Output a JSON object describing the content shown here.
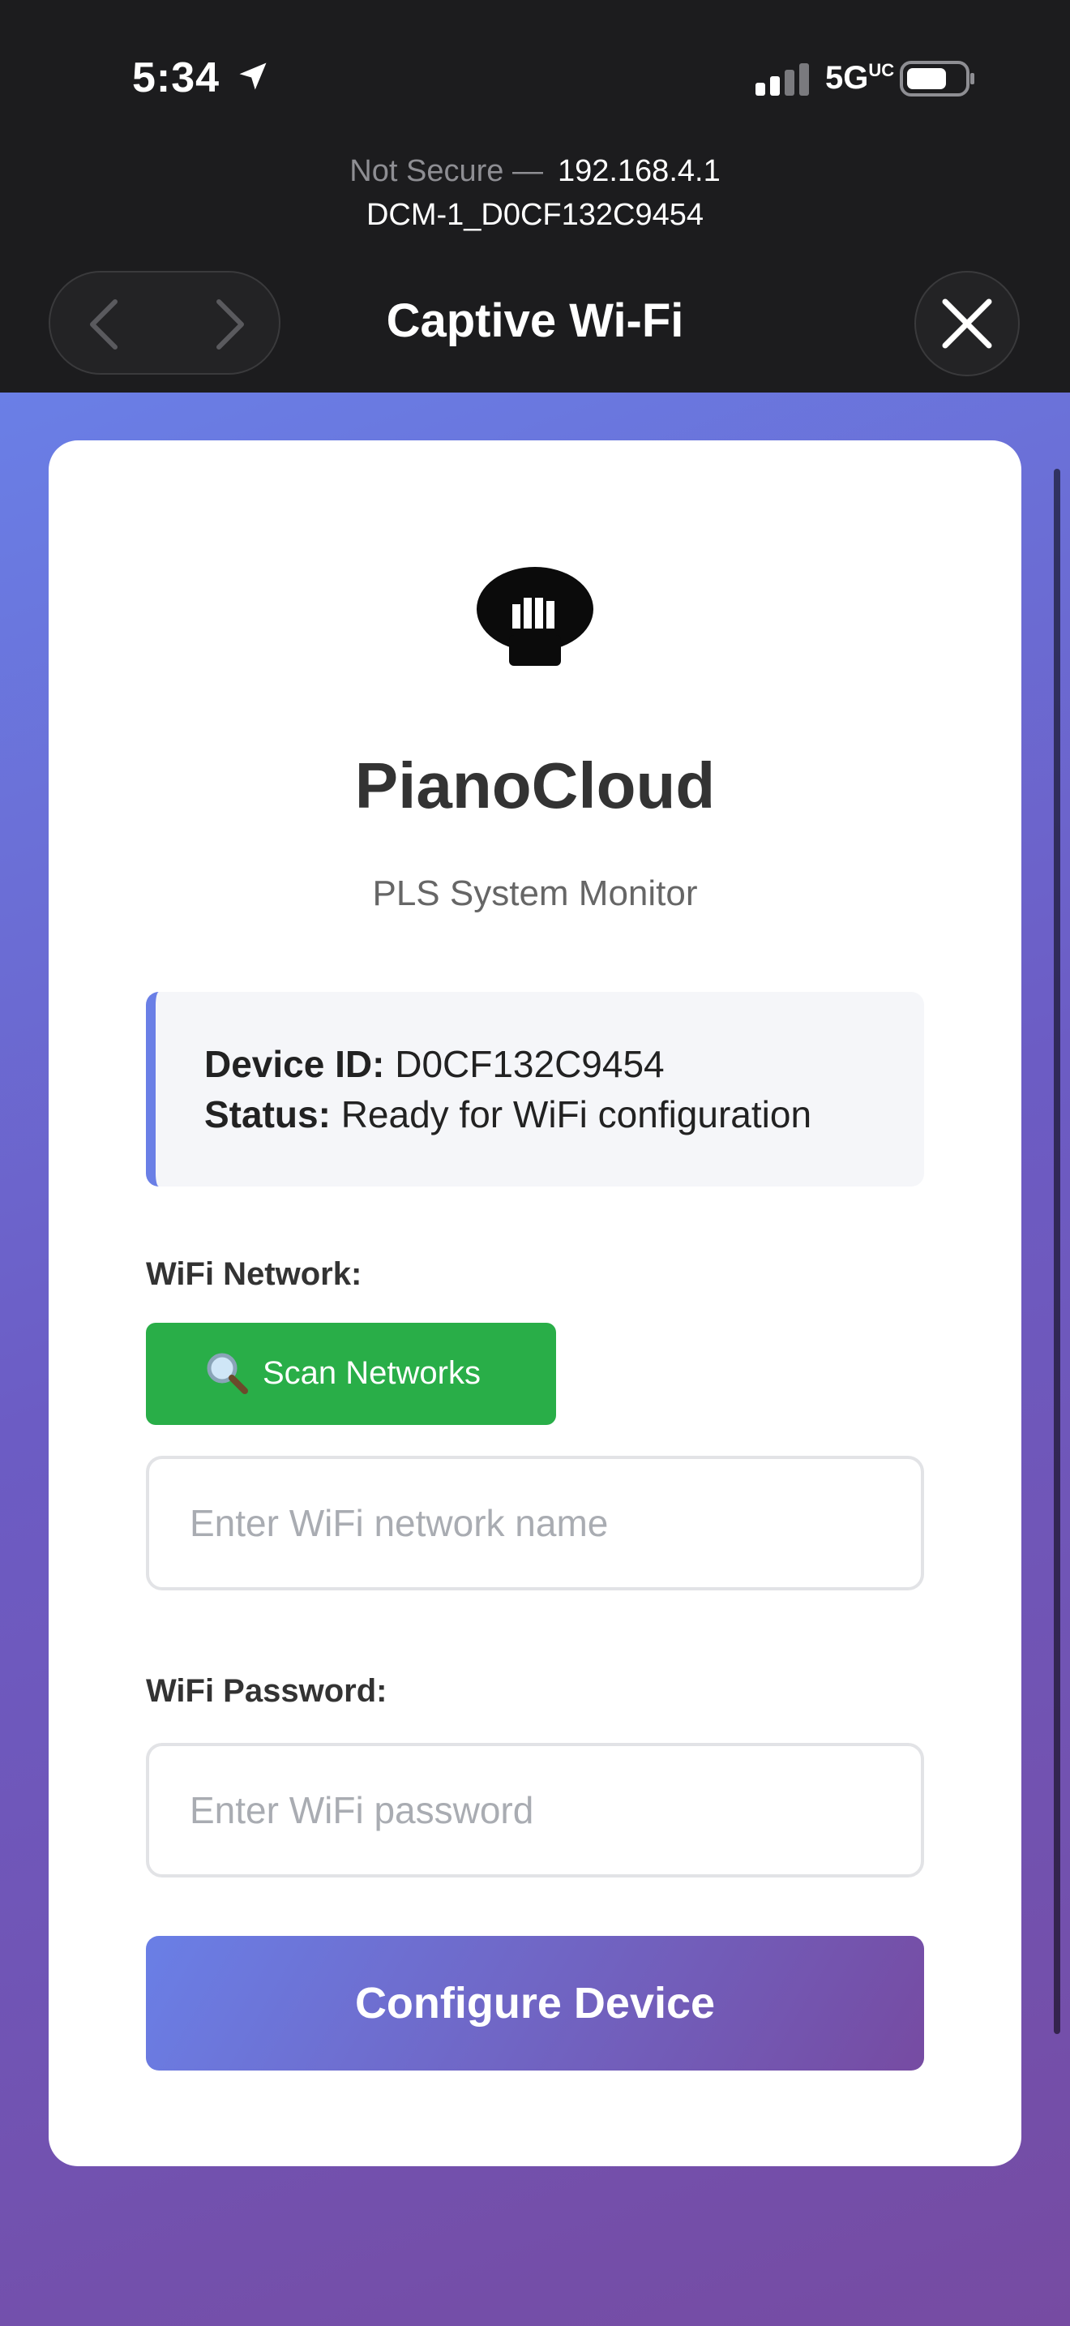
{
  "status_bar": {
    "time": "5:34",
    "network": "5G",
    "network_suffix": "UC"
  },
  "browser": {
    "security_label": "Not Secure —",
    "host": "192.168.4.1",
    "ssid": "DCM-1_D0CF132C9454",
    "title": "Captive Wi-Fi"
  },
  "app": {
    "name": "PianoCloud",
    "tagline": "PLS System Monitor"
  },
  "device_info": {
    "id_label": "Device ID:",
    "id_value": "D0CF132C9454",
    "status_label": "Status:",
    "status_value": "Ready for WiFi configuration"
  },
  "form": {
    "network_label": "WiFi Network:",
    "scan_button": "Scan Networks",
    "network_placeholder": "Enter WiFi network name",
    "network_value": "",
    "password_label": "WiFi Password:",
    "password_placeholder": "Enter WiFi password",
    "password_value": "",
    "submit_button": "Configure Device"
  },
  "colors": {
    "accent_start": "#6a7fe6",
    "accent_end": "#764ba2",
    "scan_green": "#29ae48"
  }
}
